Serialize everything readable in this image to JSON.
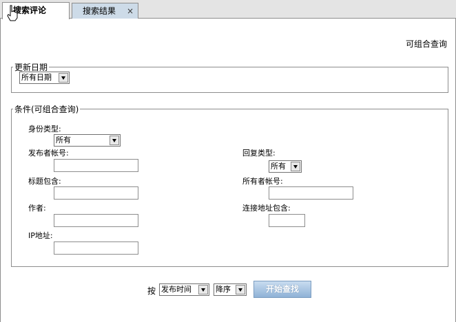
{
  "tabs": {
    "active_label": "搜索评论",
    "inactive_label": "搜索结果",
    "close_symbol": "×"
  },
  "hint": "可组合查询",
  "date_group": {
    "legend": "更新日期",
    "select_value": "所有日期"
  },
  "cond_group": {
    "legend": "条件(可组合查询)",
    "identity_label": "身份类型:",
    "identity_value": "所有",
    "poster_label": "发布者帐号:",
    "poster_value": "",
    "reply_label": "回复类型:",
    "reply_value": "所有",
    "title_label": "标题包含:",
    "title_value": "",
    "owner_label": "所有者帐号:",
    "owner_value": "",
    "author_label": "作者:",
    "author_value": "",
    "link_label": "连接地址包含:",
    "link_value": "",
    "ip_label": "IP地址:",
    "ip_value": ""
  },
  "footer": {
    "by_label": "按",
    "sort_field": "发布时间",
    "sort_order": "降序",
    "search_button": "开始查找"
  }
}
